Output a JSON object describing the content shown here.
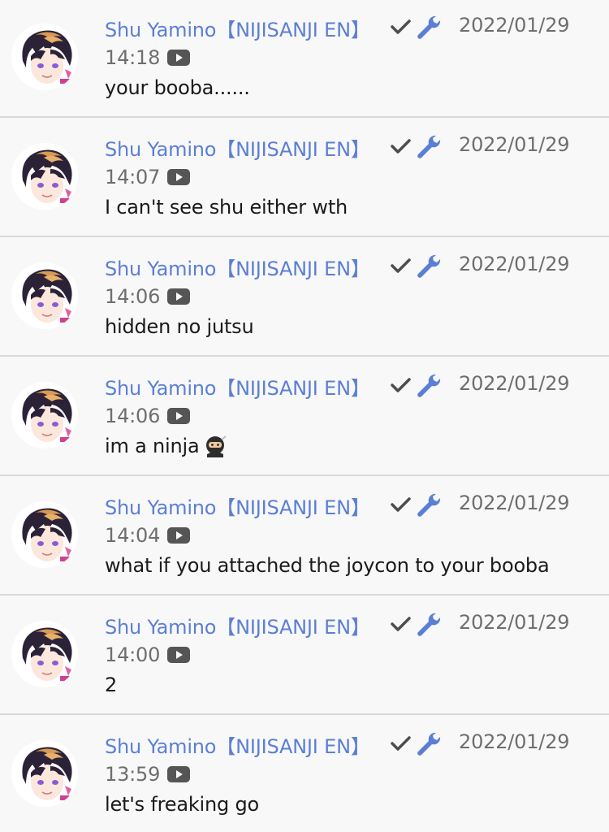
{
  "colors": {
    "author": "#5b7fd4",
    "meta": "#6e6e6e",
    "text": "#1a1a1a",
    "background": "#f8f8f8",
    "divider": "#d9d9d9"
  },
  "messages": [
    {
      "author": "Shu Yamino【NIJISANJI EN】",
      "date": "2022/01/29",
      "time": "14:18",
      "text": "your booba......",
      "icons": [
        "verified-check-icon",
        "moderator-wrench-icon",
        "youtube-icon"
      ]
    },
    {
      "author": "Shu Yamino【NIJISANJI EN】",
      "date": "2022/01/29",
      "time": "14:07",
      "text": "I can't see shu either wth",
      "icons": [
        "verified-check-icon",
        "moderator-wrench-icon",
        "youtube-icon"
      ]
    },
    {
      "author": "Shu Yamino【NIJISANJI EN】",
      "date": "2022/01/29",
      "time": "14:06",
      "text": "hidden no jutsu",
      "icons": [
        "verified-check-icon",
        "moderator-wrench-icon",
        "youtube-icon"
      ]
    },
    {
      "author": "Shu Yamino【NIJISANJI EN】",
      "date": "2022/01/29",
      "time": "14:06",
      "text": "im a ninja",
      "emoji": "ninja-emoji-icon",
      "icons": [
        "verified-check-icon",
        "moderator-wrench-icon",
        "youtube-icon"
      ]
    },
    {
      "author": "Shu Yamino【NIJISANJI EN】",
      "date": "2022/01/29",
      "time": "14:04",
      "text": "what if you attached the joycon to your booba",
      "icons": [
        "verified-check-icon",
        "moderator-wrench-icon",
        "youtube-icon"
      ]
    },
    {
      "author": "Shu Yamino【NIJISANJI EN】",
      "date": "2022/01/29",
      "time": "14:00",
      "text": "2",
      "icons": [
        "verified-check-icon",
        "moderator-wrench-icon",
        "youtube-icon"
      ]
    },
    {
      "author": "Shu Yamino【NIJISANJI EN】",
      "date": "2022/01/29",
      "time": "13:59",
      "text": "let's freaking go",
      "icons": [
        "verified-check-icon",
        "moderator-wrench-icon",
        "youtube-icon"
      ]
    }
  ]
}
